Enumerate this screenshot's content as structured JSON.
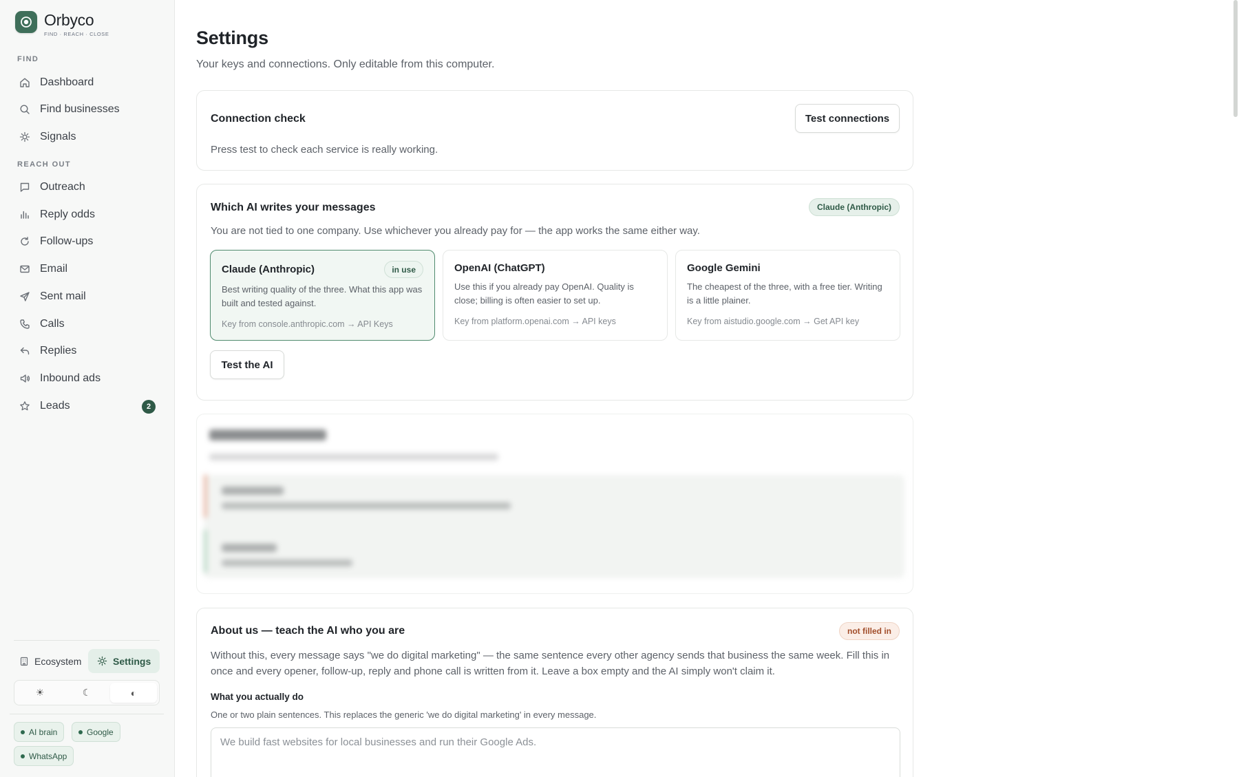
{
  "brand": {
    "name": "Orbyco",
    "tagline": "FIND · REACH · CLOSE"
  },
  "sidebar": {
    "sections": [
      {
        "label": "FIND"
      },
      {
        "label": "REACH OUT"
      }
    ],
    "items": [
      {
        "label": "Dashboard",
        "icon": "home-icon"
      },
      {
        "label": "Find businesses",
        "icon": "search-icon"
      },
      {
        "label": "Signals",
        "icon": "sun-icon"
      },
      {
        "label": "Outreach",
        "icon": "message-icon"
      },
      {
        "label": "Reply odds",
        "icon": "bar-chart-icon"
      },
      {
        "label": "Follow-ups",
        "icon": "refresh-icon"
      },
      {
        "label": "Email",
        "icon": "mail-icon"
      },
      {
        "label": "Sent mail",
        "icon": "send-icon"
      },
      {
        "label": "Calls",
        "icon": "phone-icon"
      },
      {
        "label": "Replies",
        "icon": "reply-icon"
      },
      {
        "label": "Inbound ads",
        "icon": "megaphone-icon"
      },
      {
        "label": "Leads",
        "icon": "star-icon",
        "badge": "2"
      }
    ],
    "footer": {
      "ecosystem": "Ecosystem",
      "settings": "Settings",
      "theme": {
        "light": "☀",
        "dark": "☾",
        "auto": "◐",
        "selected": "auto"
      },
      "status_pills": [
        "AI brain",
        "Google",
        "WhatsApp"
      ]
    }
  },
  "page": {
    "title": "Settings",
    "subtitle": "Your keys and connections. Only editable from this computer."
  },
  "connection_check": {
    "title": "Connection check",
    "button": "Test connections",
    "text": "Press test to check each service is really working."
  },
  "ai_provider": {
    "title": "Which AI writes your messages",
    "current_tag": "Claude (Anthropic)",
    "text": "You are not tied to one company. Use whichever you already pay for — the app works the same either way.",
    "providers": [
      {
        "name": "Claude (Anthropic)",
        "badge": "in use",
        "desc": "Best writing quality of the three. What this app was built and tested against.",
        "key": "Key from console.anthropic.com → API Keys"
      },
      {
        "name": "OpenAI (ChatGPT)",
        "desc": "Use this if you already pay OpenAI. Quality is close; billing is often easier to set up.",
        "key": "Key from platform.openai.com → API keys"
      },
      {
        "name": "Google Gemini",
        "desc": "The cheapest of the three, with a free tier. Writing is a little plainer.",
        "key": "Key from aistudio.google.com → Get API key"
      }
    ],
    "test_button": "Test the AI"
  },
  "about": {
    "title": "About us — teach the AI who you are",
    "status": "not filled in",
    "text": "Without this, every message says \"we do digital marketing\" — the same sentence every other agency sends that business the same week. Fill this in once and every opener, follow-up, reply and phone call is written from it. Leave a box empty and the AI simply won't claim it.",
    "field_label": "What you actually do",
    "field_help": "One or two plain sentences. This replaces the generic 'we do digital marketing' in every message.",
    "field_value": "",
    "field_placeholder": "We build fast websites for local businesses and run their Google Ads."
  },
  "colors": {
    "accent": "#2f5a47",
    "accent_light": "#e6f0ea",
    "warning": "#a24e2b"
  }
}
